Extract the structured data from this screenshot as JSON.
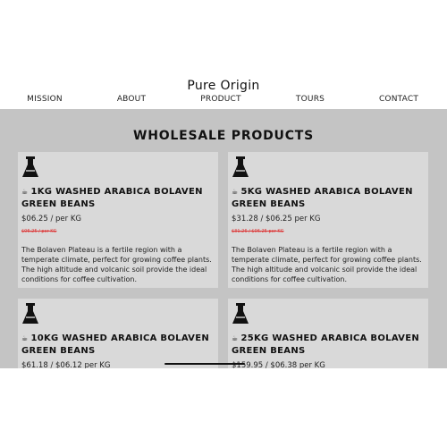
{
  "brand": "Pure Origin",
  "nav": [
    "MISSION",
    "ABOUT",
    "PRODUCT",
    "TOURS",
    "CONTACT"
  ],
  "section_title": "WHOLESALE PRODUCTS",
  "products": [
    {
      "name": "1KG WASHED ARABICA BOLAVEN GREEN BEANS",
      "price": "$06.25 / per KG",
      "old_price": "$06.25 / per KG",
      "description": "The Bolaven Plateau is a fertile region with a temperate climate, perfect for growing coffee plants. The high altitude and volcanic soil provide the ideal conditions for coffee cultivation."
    },
    {
      "name": "5KG WASHED ARABICA BOLAVEN GREEN BEANS",
      "price": "$31.28 / $06.25 per KG",
      "old_price": "$31.26 / $06.25 per KG",
      "description": "The Bolaven Plateau is a fertile region with a temperate climate, perfect for growing coffee plants. The high altitude and volcanic soil provide the ideal conditions for coffee cultivation."
    },
    {
      "name": "10KG WASHED ARABICA BOLAVEN GREEN BEANS",
      "price": "$61.18 / $06.12 per KG",
      "old_price": "",
      "description": ""
    },
    {
      "name": "25KG WASHED ARABICA BOLAVEN GREEN BEANS",
      "price": "$159.95 / $06.38 per KG",
      "old_price": "",
      "description": ""
    }
  ],
  "colors": {
    "main_bg": "#c4c4c4",
    "card_bg": "#d9d9d9",
    "strike_price": "#dd3333"
  },
  "icons": {
    "product": "flask-icon",
    "name_prefix": "coffee-bean-icon"
  }
}
